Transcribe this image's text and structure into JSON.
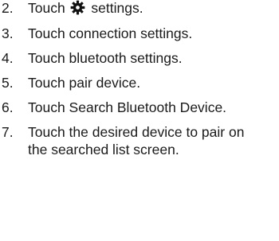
{
  "steps": [
    {
      "number": "2.",
      "text_before_icon": "Touch ",
      "icon": "gear-icon",
      "text_after_icon": " settings."
    },
    {
      "number": "3.",
      "text": "Touch connection settings."
    },
    {
      "number": "4.",
      "text": "Touch bluetooth settings."
    },
    {
      "number": "5.",
      "text": "Touch pair device."
    },
    {
      "number": "6.",
      "text": "Touch Search Bluetooth Device."
    },
    {
      "number": "7.",
      "text": "Touch the desired device to pair on the searched list screen."
    }
  ]
}
